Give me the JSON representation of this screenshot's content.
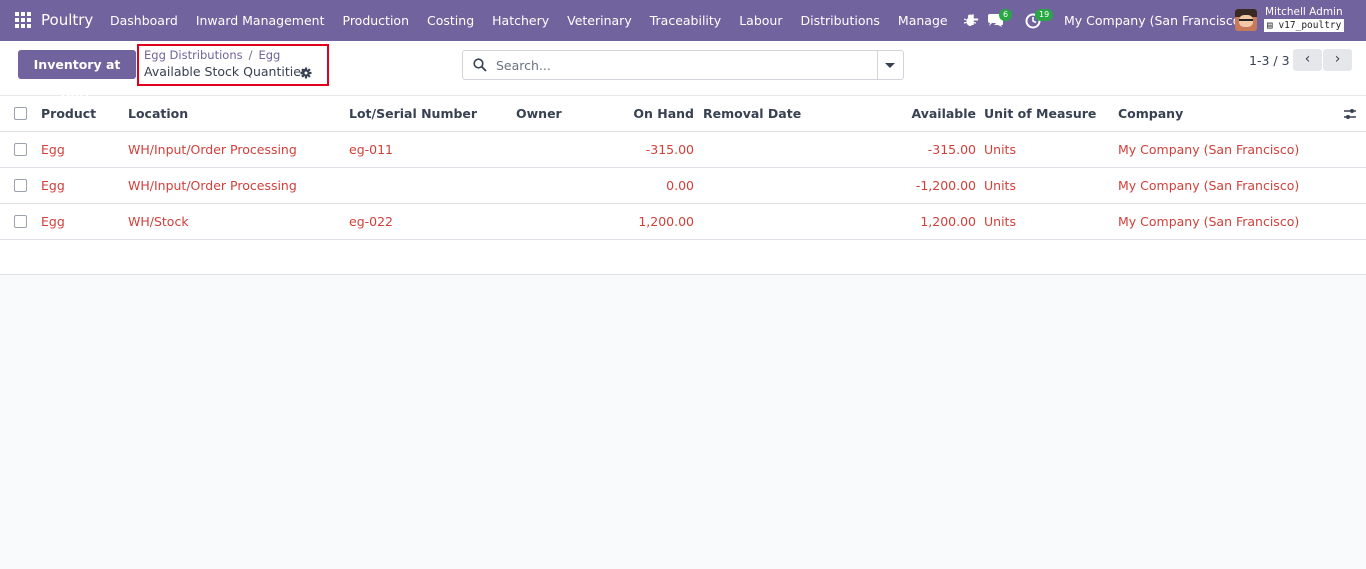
{
  "navbar": {
    "brand": "Poultry",
    "menu": [
      "Dashboard",
      "Inward Management",
      "Production",
      "Costing",
      "Hatchery",
      "Veterinary",
      "Traceability",
      "Labour",
      "Distributions",
      "Manage"
    ],
    "plus": "+",
    "chat_count": "6",
    "activity_count": "19",
    "company": "My Company (San Francisco)",
    "user_name": "Mitchell Admin",
    "database": "v17_poultry"
  },
  "control": {
    "button_label": "Inventory at Date",
    "breadcrumb": [
      "Egg Distributions",
      "Egg"
    ],
    "breadcrumb_sep": "/",
    "title": "Available Stock Quantities",
    "search_placeholder": "Search...",
    "pager": "1-3 / 3",
    "pager_prev": "‹",
    "pager_next": "›"
  },
  "table": {
    "columns": [
      "Product",
      "Location",
      "Lot/Serial Number",
      "Owner",
      "On Hand",
      "Removal Date",
      "Available",
      "Unit of Measure",
      "Company"
    ],
    "rows": [
      {
        "product": "Egg",
        "location": "WH/Input/Order Processing",
        "lot": "eg-011",
        "owner": "",
        "on_hand": "-315.00",
        "removal_date": "",
        "available": "-315.00",
        "uom": "Units",
        "company": "My Company (San Francisco)"
      },
      {
        "product": "Egg",
        "location": "WH/Input/Order Processing",
        "lot": "",
        "owner": "",
        "on_hand": "0.00",
        "removal_date": "",
        "available": "-1,200.00",
        "uom": "Units",
        "company": "My Company (San Francisco)"
      },
      {
        "product": "Egg",
        "location": "WH/Stock",
        "lot": "eg-022",
        "owner": "",
        "on_hand": "1,200.00",
        "removal_date": "",
        "available": "1,200.00",
        "uom": "Units",
        "company": "My Company (San Francisco)"
      }
    ]
  },
  "colors": {
    "navbar": "#71639e",
    "primary_button": "#71639e",
    "link": "#71639e",
    "negative_row_text": "#d23f3a",
    "highlight_box": "#e0001b",
    "badge": "#28a745"
  }
}
